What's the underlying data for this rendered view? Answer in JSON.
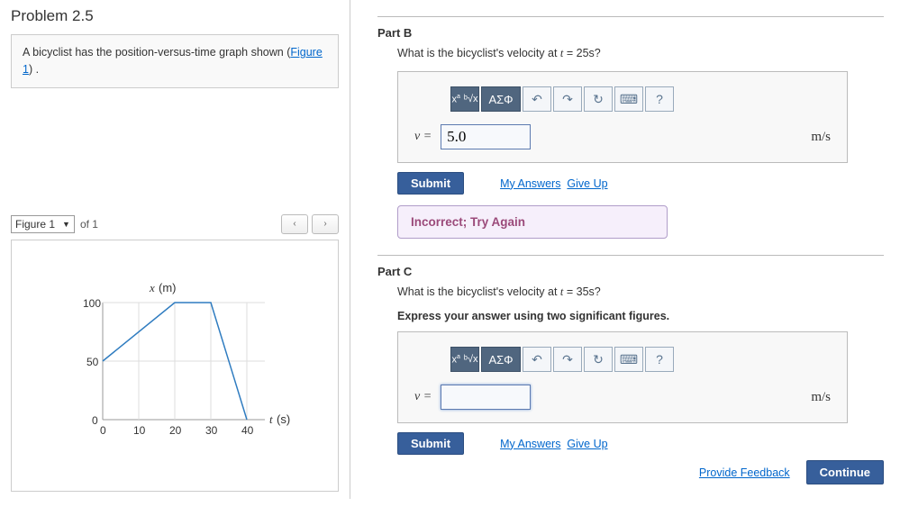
{
  "problem": {
    "title": "Problem 2.5",
    "description_pre": "A bicyclist has the position-versus-time graph shown (",
    "figure_link": "Figure 1",
    "description_post": ") ."
  },
  "figure_selector": {
    "current": "Figure 1",
    "of_label": "of 1"
  },
  "chart_data": {
    "type": "line",
    "xlabel": "t (s)",
    "ylabel": "x (m)",
    "x_ticks": [
      0,
      10,
      20,
      30,
      40
    ],
    "y_ticks": [
      0,
      50,
      100
    ],
    "xlim": [
      0,
      45
    ],
    "ylim": [
      0,
      110
    ],
    "series": [
      {
        "name": "position",
        "x": [
          0,
          20,
          30,
          40
        ],
        "y": [
          50,
          100,
          100,
          0
        ]
      }
    ]
  },
  "part_b": {
    "title": "Part B",
    "question": "What is the bicyclist's velocity at t = 25s?",
    "var_label": "v =",
    "value": "5.0",
    "unit": "m/s",
    "submit": "Submit",
    "my_answers": "My Answers",
    "give_up": "Give Up",
    "feedback": "Incorrect; Try Again"
  },
  "part_c": {
    "title": "Part C",
    "question": "What is the bicyclist's velocity at t = 35s?",
    "hint": "Express your answer using two significant figures.",
    "var_label": "v =",
    "value": "",
    "unit": "m/s",
    "submit": "Submit",
    "my_answers": "My Answers",
    "give_up": "Give Up"
  },
  "toolbar_labels": {
    "templates": "▯√",
    "greek": "ΑΣΦ",
    "undo": "↶",
    "redo": "↷",
    "reset": "↻",
    "keyboard": "⌨",
    "help": "?"
  },
  "footer": {
    "provide_feedback": "Provide Feedback",
    "continue": "Continue"
  }
}
